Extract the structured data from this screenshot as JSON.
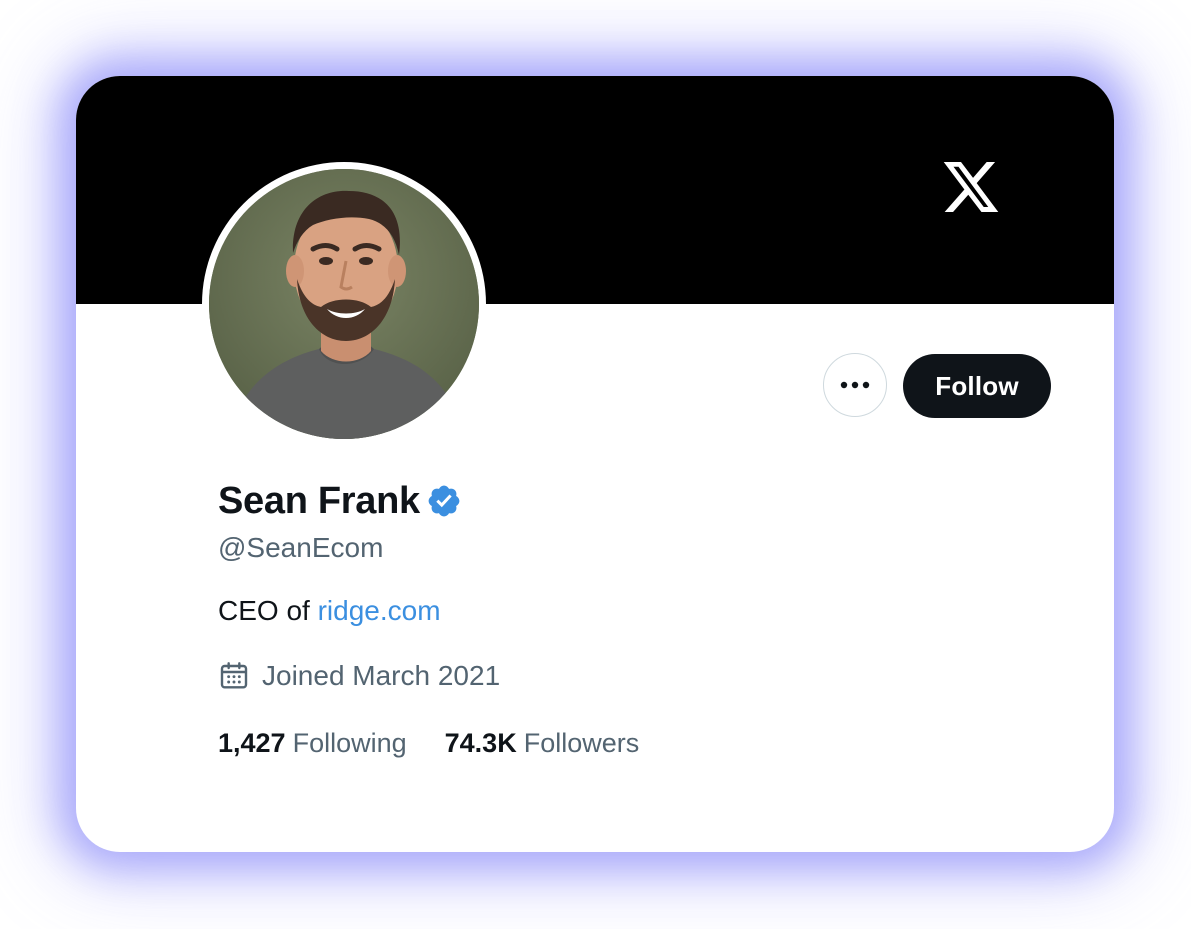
{
  "profile": {
    "display_name": "Sean Frank",
    "handle": "@SeanEcom",
    "bio_prefix": "CEO of ",
    "bio_link": "ridge.com",
    "joined": "Joined March 2021",
    "verified": true
  },
  "actions": {
    "follow_label": "Follow",
    "more_icon": "more-horizontal-icon"
  },
  "stats": {
    "following_count": "1,427",
    "following_label": "Following",
    "followers_count": "74.3K",
    "followers_label": "Followers"
  },
  "brand": {
    "logo": "x-logo-icon",
    "banner_color": "#000000",
    "verified_color": "#3b8fe0",
    "glow_color": "#8a8af5"
  }
}
